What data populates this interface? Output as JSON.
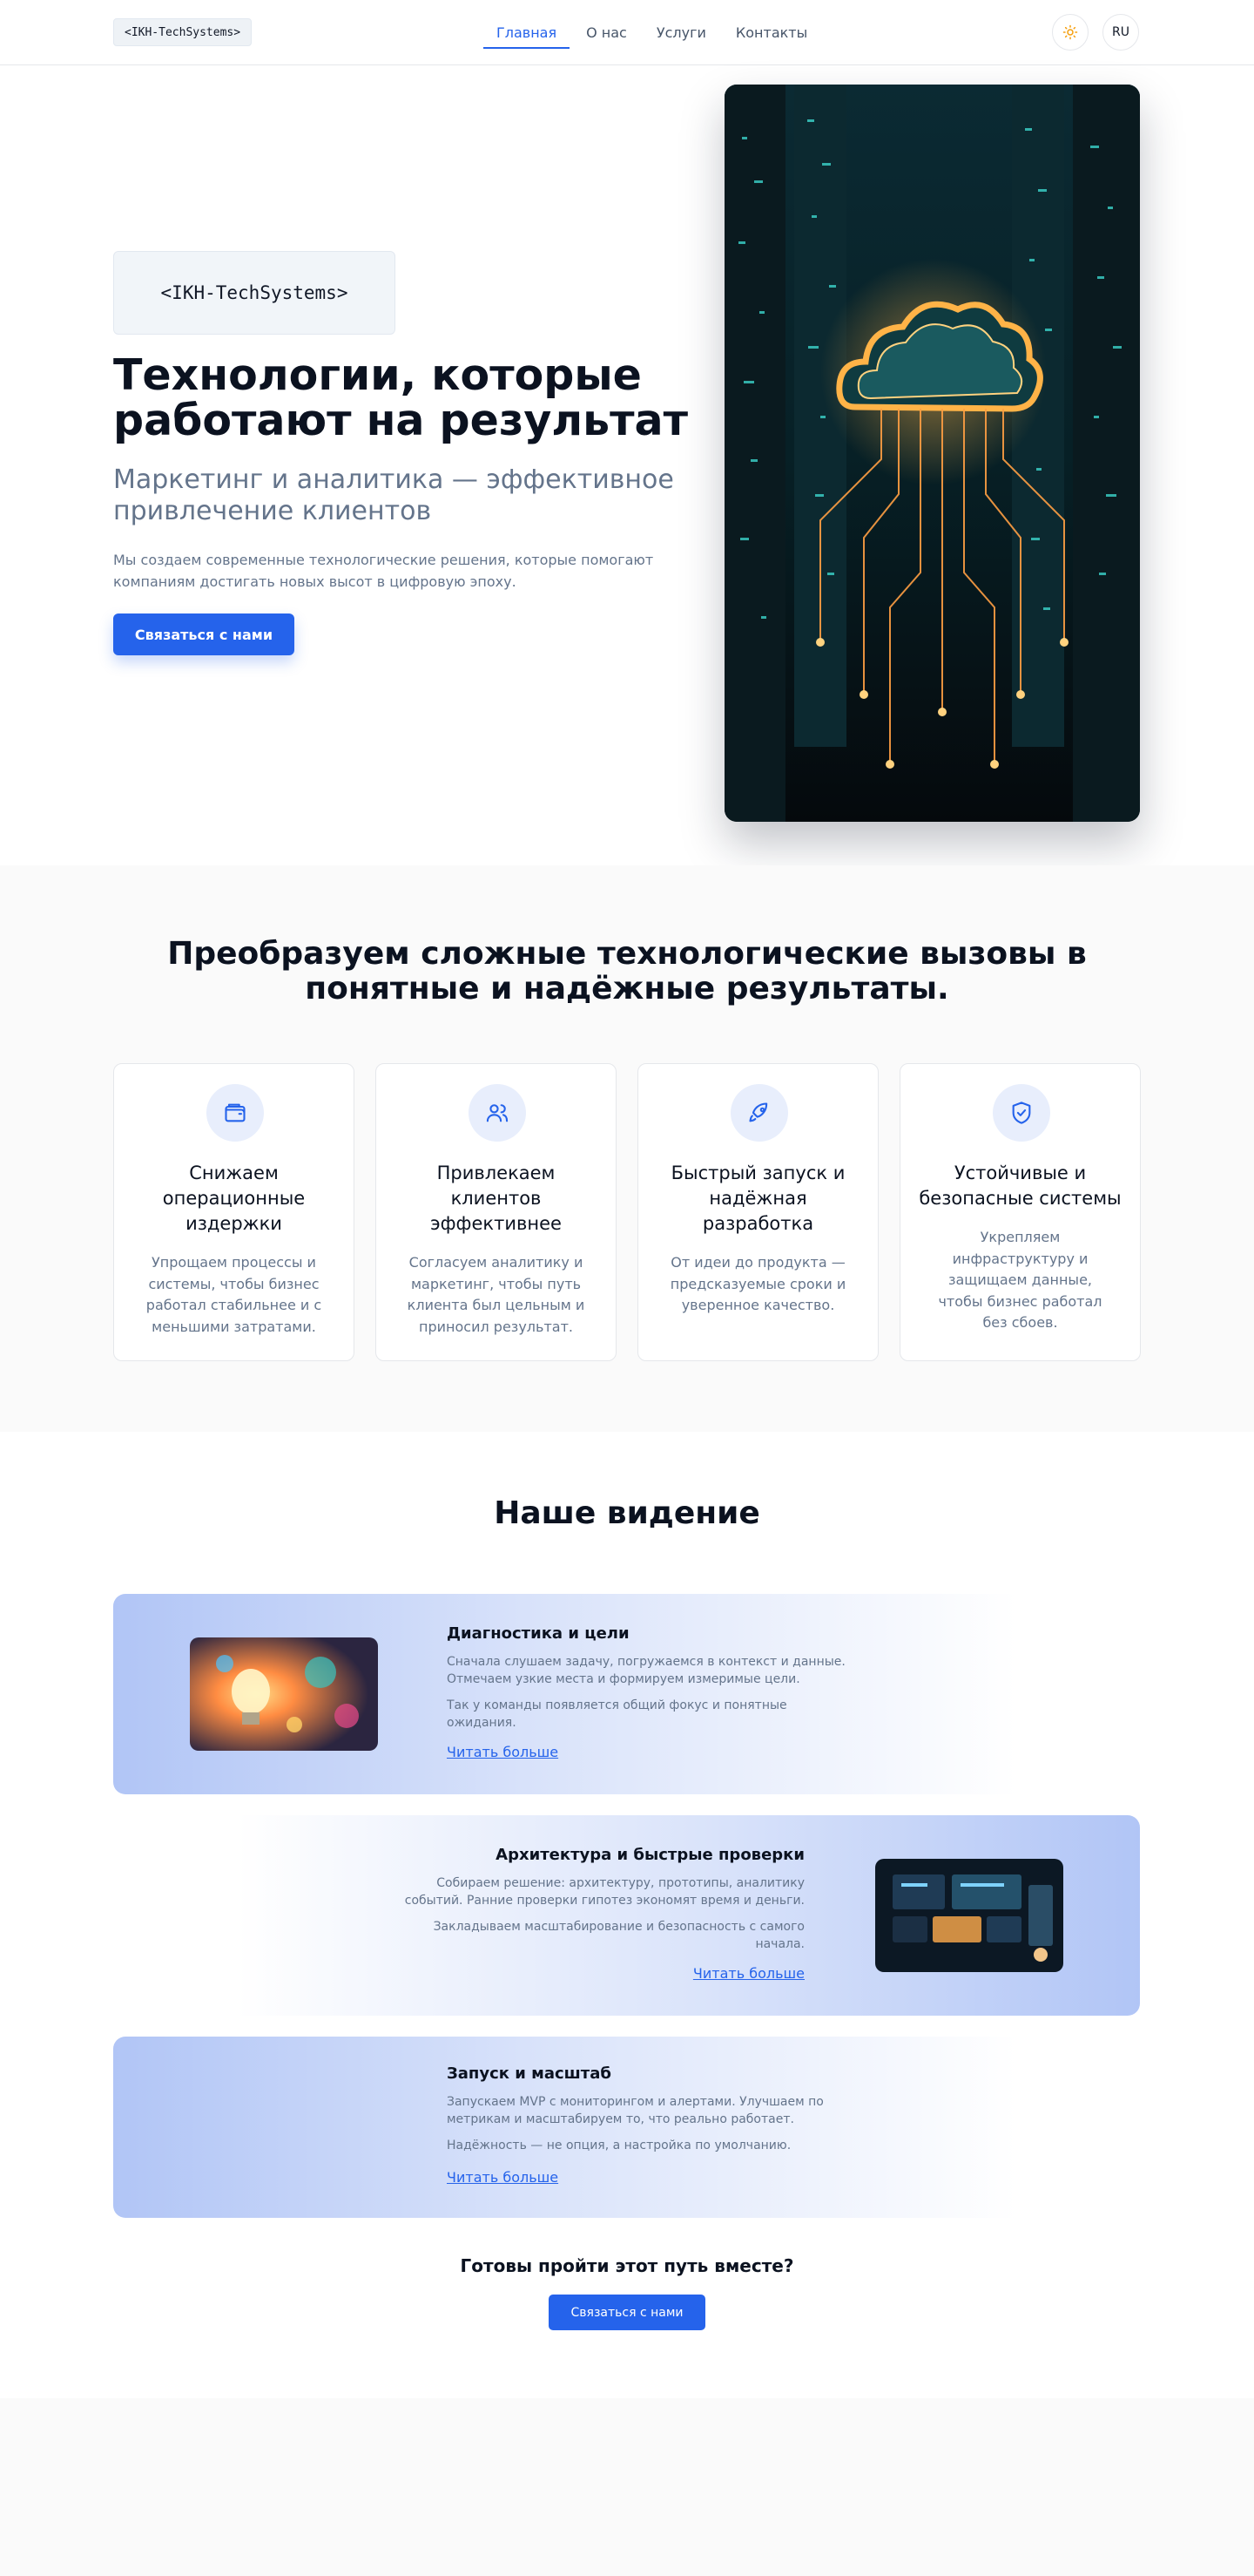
{
  "header": {
    "logo": "<IKH-TechSystems>",
    "nav": [
      "Главная",
      "О нас",
      "Услуги",
      "Контакты"
    ],
    "active_nav": "Главная",
    "lang": "RU",
    "theme_icon": "sun-icon"
  },
  "hero": {
    "badge": "<IKH-TechSystems>",
    "title": "Технологии, которые работают на результат",
    "subtitle": "Маркетинг и аналитика — эффективное привлечение клиентов",
    "description": "Мы создаем современные технологические решения, которые помогают компаниям достигать новых высот в цифровую эпоху.",
    "button": "Связаться с нами"
  },
  "features": {
    "title": "Преобразуем сложные технологические вызовы в понятные и надёжные результаты.",
    "cards": [
      {
        "icon": "wallet-icon",
        "title": "Снижаем операционные издержки",
        "text": "Упрощаем процессы и системы, чтобы бизнес работал стабильнее и с меньшими затратами."
      },
      {
        "icon": "users-icon",
        "title": "Привлекаем клиентов эффективнее",
        "text": "Согласуем аналитику и маркетинг, чтобы путь клиента был цельным и приносил результат."
      },
      {
        "icon": "rocket-icon",
        "title": "Быстрый запуск и надёжная разработка",
        "text": "От идеи до продукта — предсказуемые сроки и уверенное качество."
      },
      {
        "icon": "shield-check-icon",
        "title": "Устойчивые и безопасные системы",
        "text": "Укрепляем инфраструктуру и защищаем данные, чтобы бизнес работал без сбоев."
      }
    ]
  },
  "vision": {
    "title": "Наше видение",
    "items": [
      {
        "title": "Диагностика и цели",
        "p1": "Сначала слушаем задачу, погружаемся в контекст и данные. Отмечаем узкие места и формируем измеримые цели.",
        "p2": "Так у команды появляется общий фокус и понятные ожидания.",
        "link": "Читать больше"
      },
      {
        "title": "Архитектура и быстрые проверки",
        "p1": "Собираем решение: архитектуру, прототипы, аналитику событий. Ранние проверки гипотез экономят время и деньги.",
        "p2": "Закладываем масштабирование и безопасность с самого начала.",
        "link": "Читать больше"
      },
      {
        "title": "Запуск и масштаб",
        "p1": "Запускаем MVP с мониторингом и алертами. Улучшаем по метрикам и масштабируем то, что реально работает.",
        "p2": "Надёжность — не опция, а настройка по умолчанию.",
        "link": "Читать больше"
      }
    ]
  },
  "cta": {
    "title": "Готовы пройти этот путь вместе?",
    "button": "Связаться с нами"
  }
}
